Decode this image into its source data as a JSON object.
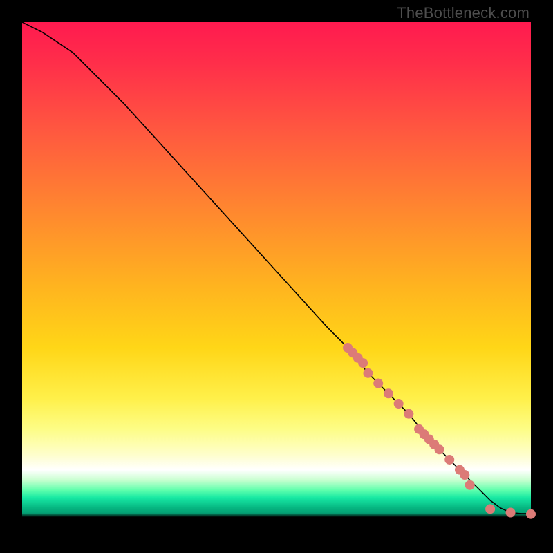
{
  "credit": "TheBottleneck.com",
  "colors": {
    "dot": "#dc7b77",
    "curve": "#000000"
  },
  "chart_data": {
    "type": "line",
    "title": "",
    "xlabel": "",
    "ylabel": "",
    "xlim": [
      0,
      100
    ],
    "ylim": [
      0,
      100
    ],
    "grid": false,
    "legend": false,
    "series": [
      {
        "name": "curve",
        "kind": "line",
        "x": [
          0,
          4,
          10,
          20,
          30,
          40,
          50,
          60,
          64,
          68,
          72,
          76,
          80,
          83,
          86,
          88,
          90,
          92,
          94,
          96,
          98,
          100
        ],
        "y": [
          100,
          98,
          94,
          84,
          73,
          62,
          51,
          40,
          36,
          31,
          27,
          23,
          18,
          15,
          12,
          10,
          8,
          6,
          4.5,
          3.6,
          3.4,
          3.4
        ]
      },
      {
        "name": "dots",
        "kind": "scatter",
        "x": [
          64,
          65,
          66,
          67,
          68,
          70,
          72,
          74,
          76,
          78,
          79,
          80,
          81,
          82,
          84,
          86,
          87,
          88,
          92,
          96,
          100
        ],
        "y": [
          36,
          35,
          34,
          33,
          31,
          29,
          27,
          25,
          23,
          20,
          19,
          18,
          17,
          16,
          14,
          12,
          11,
          9,
          4.3,
          3.6,
          3.3
        ]
      }
    ]
  }
}
